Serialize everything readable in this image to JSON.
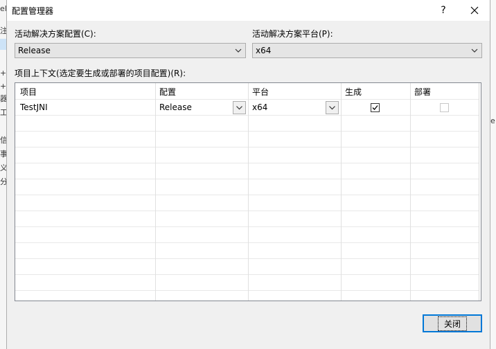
{
  "dialog": {
    "title": "配置管理器",
    "help_label": "?",
    "close_glyph": "✕"
  },
  "active_config": {
    "label": "活动解决方案配置(C):",
    "value": "Release"
  },
  "active_platform": {
    "label": "活动解决方案平台(P):",
    "value": "x64"
  },
  "contexts": {
    "label": "项目上下文(选定要生成或部署的项目配置)(R):",
    "columns": [
      "项目",
      "配置",
      "平台",
      "生成",
      "部署"
    ],
    "rows": [
      {
        "project": "TestJNI",
        "config": "Release",
        "platform": "x64",
        "build": true,
        "deploy": false
      }
    ]
  },
  "footer": {
    "close_label": "关闭"
  },
  "background_glyphs": {
    "left": [
      "el",
      "注",
      "+",
      "+",
      "器",
      "工",
      "信",
      "事",
      "义",
      "分"
    ],
    "right": [
      "e"
    ]
  }
}
